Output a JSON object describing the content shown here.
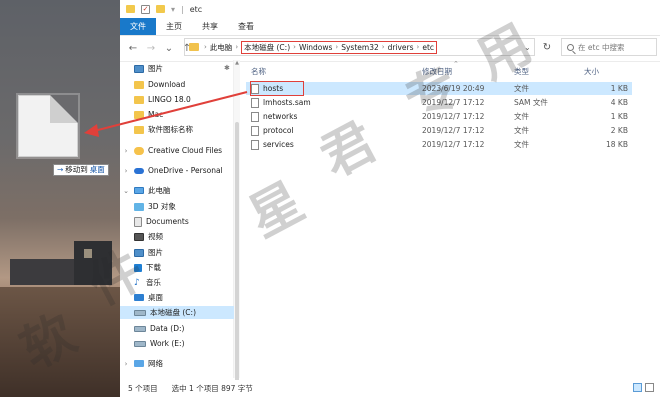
{
  "desktop": {
    "move_tip_arrow": "→",
    "move_tip_text": "移动到",
    "move_tip_target": "桌面"
  },
  "window": {
    "title": "etc",
    "ribbon_tabs": [
      "文件",
      "主页",
      "共享",
      "查看"
    ],
    "address": [
      "此电脑",
      "本地磁盘 (C:)",
      "Windows",
      "System32",
      "drivers",
      "etc"
    ],
    "search_placeholder": "在 etc 中搜索"
  },
  "nav": {
    "items": [
      {
        "label": "图片",
        "icon": "pictures-folder-icon",
        "pinned": true
      },
      {
        "label": "Download",
        "icon": "folder-icon"
      },
      {
        "label": "LINGO 18.0",
        "icon": "folder-icon"
      },
      {
        "label": "Mac",
        "icon": "folder-icon"
      },
      {
        "label": "软件图标名称",
        "icon": "folder-icon"
      },
      {
        "label": "Creative Cloud Files",
        "icon": "creative-cloud-icon"
      },
      {
        "label": "OneDrive - Personal",
        "icon": "onedrive-icon"
      },
      {
        "label": "此电脑",
        "icon": "this-pc-icon"
      },
      {
        "label": "3D 对象",
        "icon": "3d-objects-icon"
      },
      {
        "label": "Documents",
        "icon": "documents-icon"
      },
      {
        "label": "视频",
        "icon": "videos-icon"
      },
      {
        "label": "图片",
        "icon": "pictures-icon"
      },
      {
        "label": "下载",
        "icon": "downloads-icon"
      },
      {
        "label": "音乐",
        "icon": "music-icon"
      },
      {
        "label": "桌面",
        "icon": "desktop-icon"
      },
      {
        "label": "本地磁盘 (C:)",
        "icon": "drive-icon",
        "selected": true
      },
      {
        "label": "Data (D:)",
        "icon": "drive-icon"
      },
      {
        "label": "Work (E:)",
        "icon": "drive-icon"
      },
      {
        "label": "网络",
        "icon": "network-icon"
      }
    ]
  },
  "list": {
    "columns": [
      "名称",
      "修改日期",
      "类型",
      "大小"
    ],
    "files": [
      {
        "name": "hosts",
        "date": "2023/6/19 20:49",
        "type": "文件",
        "size": "1 KB",
        "selected": true
      },
      {
        "name": "lmhosts.sam",
        "date": "2019/12/7 17:12",
        "type": "SAM 文件",
        "size": "4 KB"
      },
      {
        "name": "networks",
        "date": "2019/12/7 17:12",
        "type": "文件",
        "size": "1 KB"
      },
      {
        "name": "protocol",
        "date": "2019/12/7 17:12",
        "type": "文件",
        "size": "2 KB"
      },
      {
        "name": "services",
        "date": "2019/12/7 17:12",
        "type": "文件",
        "size": "18 KB"
      }
    ]
  },
  "status": {
    "count": "5 个项目",
    "selected": "选中 1 个项目  897 字节"
  },
  "watermark": [
    "软",
    "件",
    "星",
    "君",
    "专",
    "用"
  ],
  "colors": {
    "accent": "#1979ca",
    "selection": "#cce8ff",
    "highlight_box": "#e0403a",
    "arrow": "#e0403a"
  }
}
